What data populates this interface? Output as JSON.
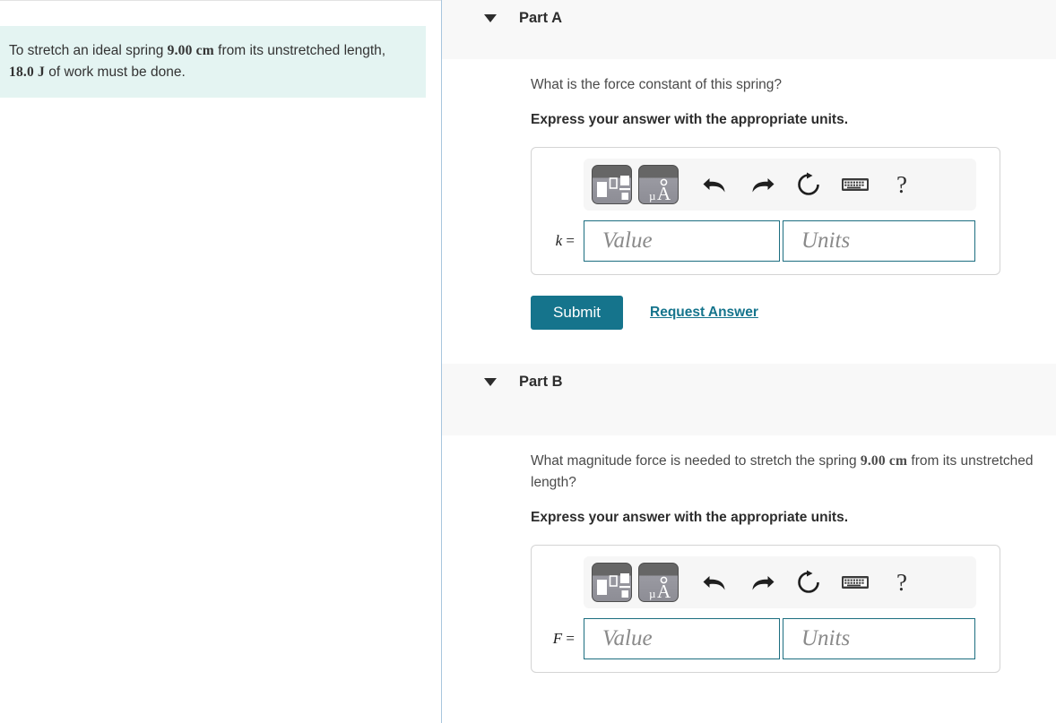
{
  "problem": {
    "text_part1": "To stretch an ideal spring ",
    "value1": "9.00",
    "unit1": "cm",
    "text_part2": " from its unstretched length, ",
    "value2": "18.0",
    "unit2": "J",
    "text_part3": " of work must be done.",
    "background_color": "#e4f4f2"
  },
  "toolbar": {
    "template_button_label": "math-template",
    "units_button_label": "units-template",
    "undo_label": "undo",
    "redo_label": "redo",
    "reset_label": "reset",
    "keyboard_label": "keyboard",
    "help_label": "?"
  },
  "parts": [
    {
      "id": "part-a",
      "title": "Part A",
      "question": "What is the force constant of this spring?",
      "instruction": "Express your answer with the appropriate units.",
      "variable": "k",
      "equals": "=",
      "value_placeholder": "Value",
      "units_placeholder": "Units",
      "value": "",
      "units": "",
      "submit_label": "Submit",
      "request_answer_label": "Request Answer"
    },
    {
      "id": "part-b",
      "title": "Part B",
      "question_line1": "What magnitude force is needed to stretch the spring ",
      "question_value": "9.00",
      "question_unit": "cm",
      "question_line2": " from its unstretched length?",
      "instruction": "Express your answer with the appropriate units.",
      "variable": "F",
      "equals": "=",
      "value_placeholder": "Value",
      "units_placeholder": "Units",
      "value": "",
      "units": ""
    }
  ],
  "colors": {
    "accent": "#15748c",
    "field_border": "#1c6e80",
    "header_band": "#f8f8f8",
    "divider": "#a8c6de"
  }
}
